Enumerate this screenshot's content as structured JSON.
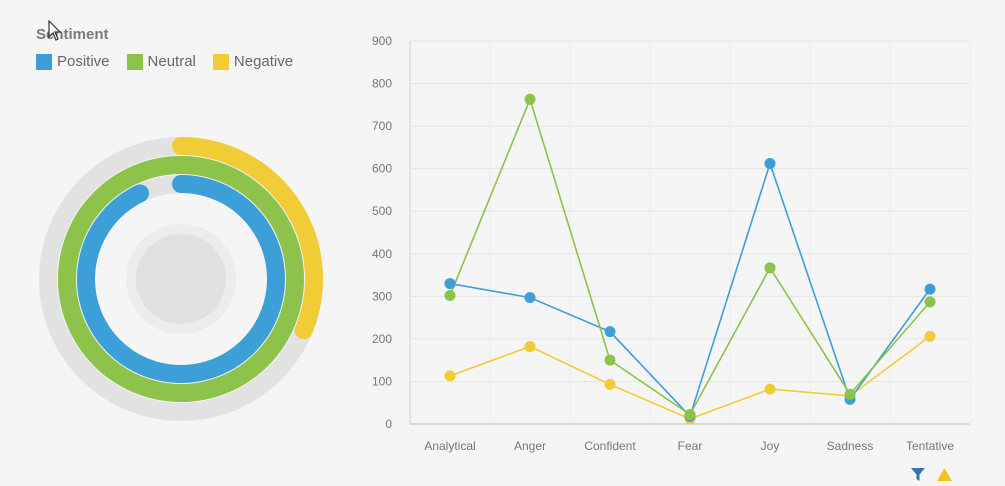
{
  "legend": {
    "title": "Sentiment",
    "items": [
      {
        "label": "Positive",
        "color": "#3d9fd8"
      },
      {
        "label": "Neutral",
        "color": "#8dc34a"
      },
      {
        "label": "Negative",
        "color": "#f2cc37"
      }
    ]
  },
  "donut_data": {
    "type": "radial-bar",
    "series": [
      {
        "name": "Negative",
        "color": "#f2cc37",
        "fraction": 0.32
      },
      {
        "name": "Neutral",
        "color": "#8dc34a",
        "fraction": 1.0
      },
      {
        "name": "Positive",
        "color": "#3d9fd8",
        "fraction": 0.95
      }
    ]
  },
  "chart_data": {
    "type": "line",
    "categories": [
      "Analytical",
      "Anger",
      "Confident",
      "Fear",
      "Joy",
      "Sadness",
      "Tentative"
    ],
    "ylim": [
      0,
      900
    ],
    "yticks": [
      "0",
      "100",
      "200",
      "300",
      "400",
      "500",
      "600",
      "700",
      "800",
      "900"
    ],
    "grid": true,
    "series": [
      {
        "name": "Positive",
        "color": "#3d9fd8",
        "values": [
          330,
          297,
          217,
          18,
          612,
          58,
          317
        ]
      },
      {
        "name": "Neutral",
        "color": "#8dc34a",
        "values": [
          302,
          763,
          150,
          22,
          367,
          70,
          287
        ]
      },
      {
        "name": "Negative",
        "color": "#f2cc37",
        "values": [
          113,
          182,
          93,
          12,
          82,
          66,
          206
        ]
      }
    ]
  },
  "toolbar": {
    "icons": [
      "filter-icon",
      "warning-icon"
    ],
    "filter_color": "#3a6fb0",
    "warning_color": "#f2c318"
  }
}
